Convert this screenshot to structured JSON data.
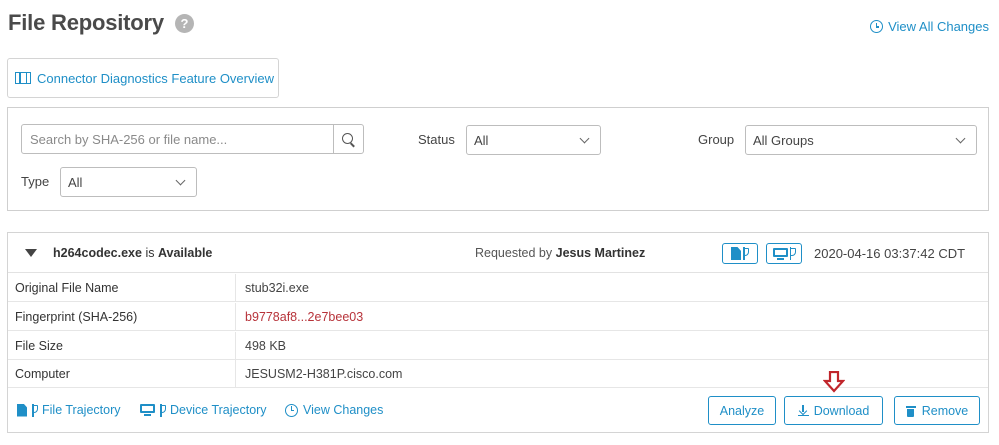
{
  "header": {
    "title": "File Repository",
    "help_glyph": "?",
    "view_all_changes": "View All Changes"
  },
  "overview": {
    "label": "Connector Diagnostics Feature Overview"
  },
  "filters": {
    "search_placeholder": "Search by SHA-256 or file name...",
    "status_label": "Status",
    "status_value": "All",
    "group_label": "Group",
    "group_value": "All Groups",
    "type_label": "Type",
    "type_value": "All"
  },
  "file": {
    "name": "h264codec.exe",
    "is_text": "is",
    "availability": "Available",
    "requested_by_label": "Requested by",
    "requested_by": "Jesus Martinez",
    "timestamp": "2020-04-16 03:37:42 CDT",
    "details": [
      {
        "label": "Original File Name",
        "value": "stub32i.exe"
      },
      {
        "label": "Fingerprint (SHA-256)",
        "value": "b9778af8...2e7bee03"
      },
      {
        "label": "File Size",
        "value": "498 KB"
      },
      {
        "label": "Computer",
        "value": "JESUSM2-H381P.cisco.com"
      }
    ],
    "links": {
      "file_trajectory": "File Trajectory",
      "device_trajectory": "Device Trajectory",
      "view_changes": "View Changes"
    },
    "actions": {
      "analyze": "Analyze",
      "download": "Download",
      "remove": "Remove"
    }
  },
  "colors": {
    "accent": "#1f8fc7",
    "fingerprint": "#b7333a",
    "annotation_arrow": "#c0252b"
  }
}
